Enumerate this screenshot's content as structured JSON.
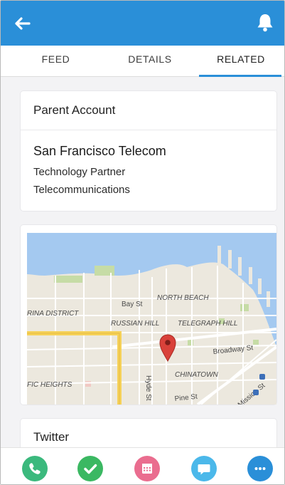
{
  "header": {
    "back_icon": "arrow-left-icon",
    "notifications_icon": "bell-icon",
    "color": "#2a8fd8"
  },
  "tabs": [
    {
      "label": "FEED",
      "active": false
    },
    {
      "label": "DETAILS",
      "active": false
    },
    {
      "label": "RELATED",
      "active": true
    }
  ],
  "parent_account": {
    "heading": "Parent Account",
    "name": "San Francisco Telecom",
    "type": "Technology Partner",
    "industry": "Telecommunications"
  },
  "map": {
    "labels": {
      "bay_st": "Bay St",
      "north_beach": "NORTH BEACH",
      "marina_district": "RINA DISTRICT",
      "russian_hill": "RUSSIAN HILL",
      "telegraph_hill": "TELEGRAPH HILL",
      "broadway_st": "Broadway St",
      "chinatown": "CHINATOWN",
      "pacific_heights": "FIC HEIGHTS",
      "hyde_st": "Hyde St",
      "pine_st": "Pine St",
      "mission_st": "Mission St"
    },
    "pin_icon": "map-pin-icon",
    "colors": {
      "water": "#a4c9f0",
      "land": "#ece8de",
      "highway": "#f6d25a",
      "pin": "#d9413a"
    }
  },
  "twitter": {
    "heading": "Twitter"
  },
  "actions": [
    {
      "icon": "phone-icon",
      "color": "#3bb97d"
    },
    {
      "icon": "check-icon",
      "color": "#3bb862"
    },
    {
      "icon": "calendar-icon",
      "color": "#ea6d8f"
    },
    {
      "icon": "chat-bubble-icon",
      "color": "#4bb8ea"
    },
    {
      "icon": "more-icon",
      "color": "#2a8fd8"
    }
  ]
}
